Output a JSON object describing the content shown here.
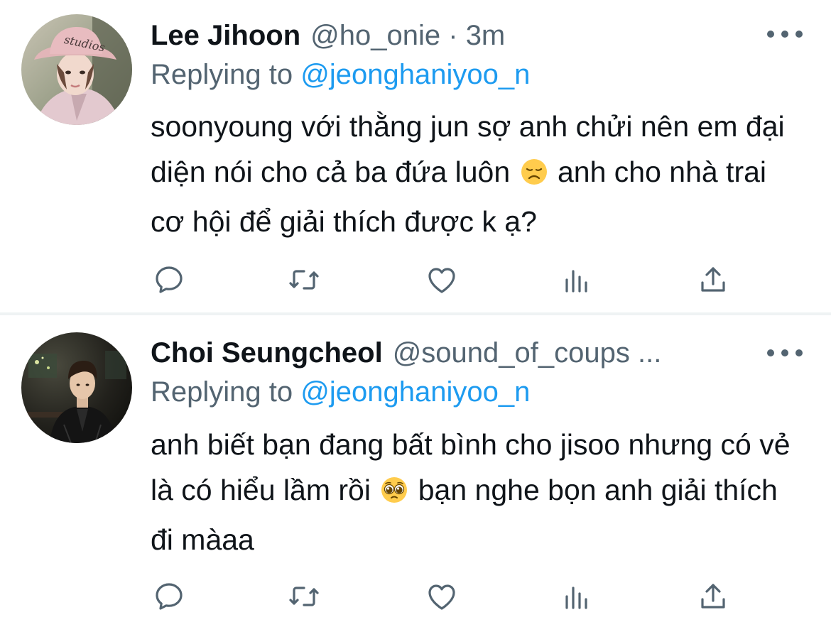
{
  "tweets": [
    {
      "display_name": "Lee Jihoon",
      "handle": "@ho_onie",
      "separator": "·",
      "time": "3m",
      "replying_prefix": "Replying to",
      "replying_to": "@jeonghaniyoo_n",
      "text_part1": "soonyoung với thằng jun sợ anh chửi nên em đại diện nói cho cả ba đứa luôn",
      "emoji": "disappointed-face",
      "text_part2": "anh cho nhà trai cơ hội để giải thích được k ạ?",
      "avatar_image": "person-in-pink-bucket-hat",
      "avatar_hat_text": "studios"
    },
    {
      "display_name": "Choi Seungcheol",
      "handle": "@sound_of_coups ...",
      "replying_prefix": "Replying to",
      "replying_to": "@jeonghaniyoo_n",
      "text_part1": "anh biết bạn đang bất bình cho jisoo nhưng có vẻ là có hiểu lầm rồi",
      "emoji": "pleading-face",
      "text_part2": "bạn nghe bọn anh giải thích đi màaa",
      "avatar_image": "person-in-black-leather-jacket"
    }
  ],
  "icons": {
    "more": "more-icon",
    "reply": "reply-icon",
    "retweet": "retweet-icon",
    "like": "heart-icon",
    "stats": "analytics-icon",
    "share": "share-icon"
  },
  "colors": {
    "text": "#0f1419",
    "secondary": "#536471",
    "link": "#1d9bf0",
    "divider": "#eff3f4"
  }
}
